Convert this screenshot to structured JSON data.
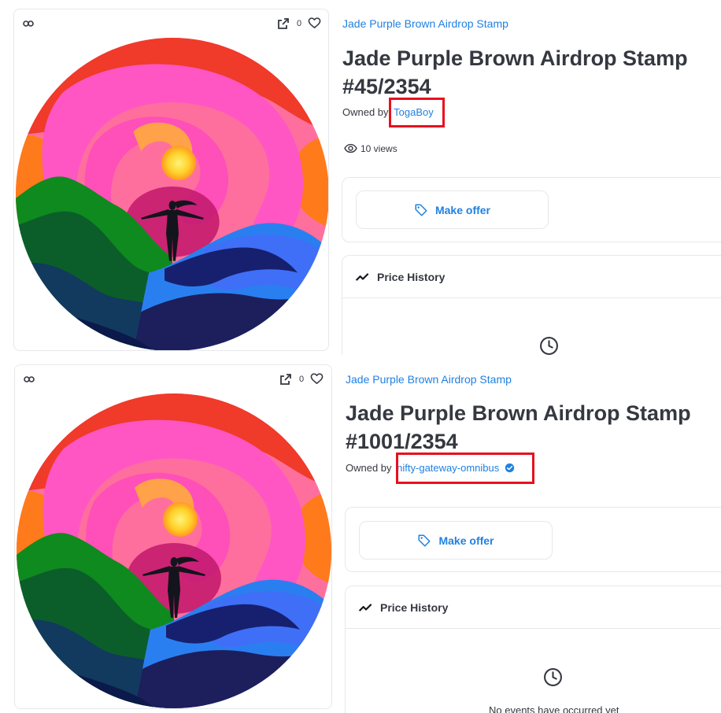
{
  "colors": {
    "accent": "#2081e2",
    "text": "#353840",
    "border": "#e5e8eb",
    "highlight": "#e8101e"
  },
  "icons": {
    "chain": "chain-link-icon",
    "external": "external-link-icon",
    "favorite": "heart-icon",
    "views": "eye-icon",
    "offer": "tag-icon",
    "history": "trend-icon",
    "empty": "clock-icon",
    "verified": "verified-badge-icon"
  },
  "listings": [
    {
      "favorites": "0",
      "collection": "Jade Purple Brown Airdrop Stamp",
      "title_line1": "Jade Purple Brown Airdrop Stamp",
      "title_line2": "#45/2354",
      "owned_by": "Owned by",
      "owner": "TogaBoy",
      "views": "10 views",
      "make_offer": "Make offer",
      "price_history": "Price History"
    },
    {
      "favorites": "0",
      "collection": "Jade Purple Brown Airdrop Stamp",
      "title_line1": "Jade Purple Brown Airdrop Stamp",
      "title_line2": "#1001/2354",
      "owned_by": "Owned by",
      "owner": "nifty-gateway-omnibus",
      "make_offer": "Make offer",
      "price_history": "Price History",
      "empty_history": "No events have occurred yet"
    }
  ]
}
